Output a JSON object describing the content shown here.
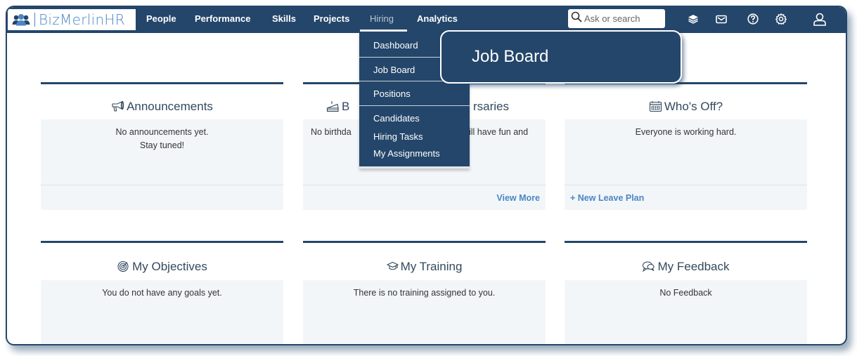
{
  "app": {
    "logo_text": "BizMerlinHR"
  },
  "navbar": {
    "items": [
      {
        "label": "People",
        "active": false
      },
      {
        "label": "Performance",
        "active": false
      },
      {
        "label": "Skills",
        "active": false
      },
      {
        "label": "Projects",
        "active": false
      },
      {
        "label": "Hiring",
        "active": true
      },
      {
        "label": "Analytics",
        "active": false
      }
    ],
    "search": {
      "placeholder": "Ask or search",
      "value": ""
    },
    "icons": [
      "layers-icon",
      "mail-icon",
      "help-icon",
      "settings-icon",
      "user-profile-icon"
    ]
  },
  "hiring_menu": {
    "items": [
      {
        "label": "Dashboard"
      },
      {
        "label": "Job Board"
      },
      {
        "label": "Positions"
      },
      {
        "label": "Candidates"
      },
      {
        "label": "Hiring Tasks"
      },
      {
        "label": "My Assignments"
      }
    ]
  },
  "callout": {
    "text": "Job Board"
  },
  "cards": {
    "announcements": {
      "title": "Announcements",
      "icon": "megaphone-icon",
      "body_line1": "No announcements yet.",
      "body_line2": "Stay tuned!"
    },
    "birthdays": {
      "title_prefix": "B",
      "title_suffix": "rsaries",
      "icon": "cake-icon",
      "body_prefix": "No birthda",
      "body_suffix": "ill have fun and",
      "footer_link": "View More"
    },
    "whos_off": {
      "title": "Who's Off?",
      "icon": "calendar-icon",
      "body": "Everyone is working hard.",
      "footer_link": "+ New Leave Plan"
    },
    "objectives": {
      "title": "My Objectives",
      "icon": "target-icon",
      "body": "You do not have any goals yet."
    },
    "training": {
      "title": "My Training",
      "icon": "graduation-cap-icon",
      "body": "There is no training assigned to you."
    },
    "feedback": {
      "title": "My Feedback",
      "icon": "chat-bubbles-icon",
      "body": "No Feedback"
    }
  },
  "colors": {
    "brand_navy": "#24466a",
    "brand_blue": "#4a86c5",
    "card_bg": "#f3f6f9"
  }
}
